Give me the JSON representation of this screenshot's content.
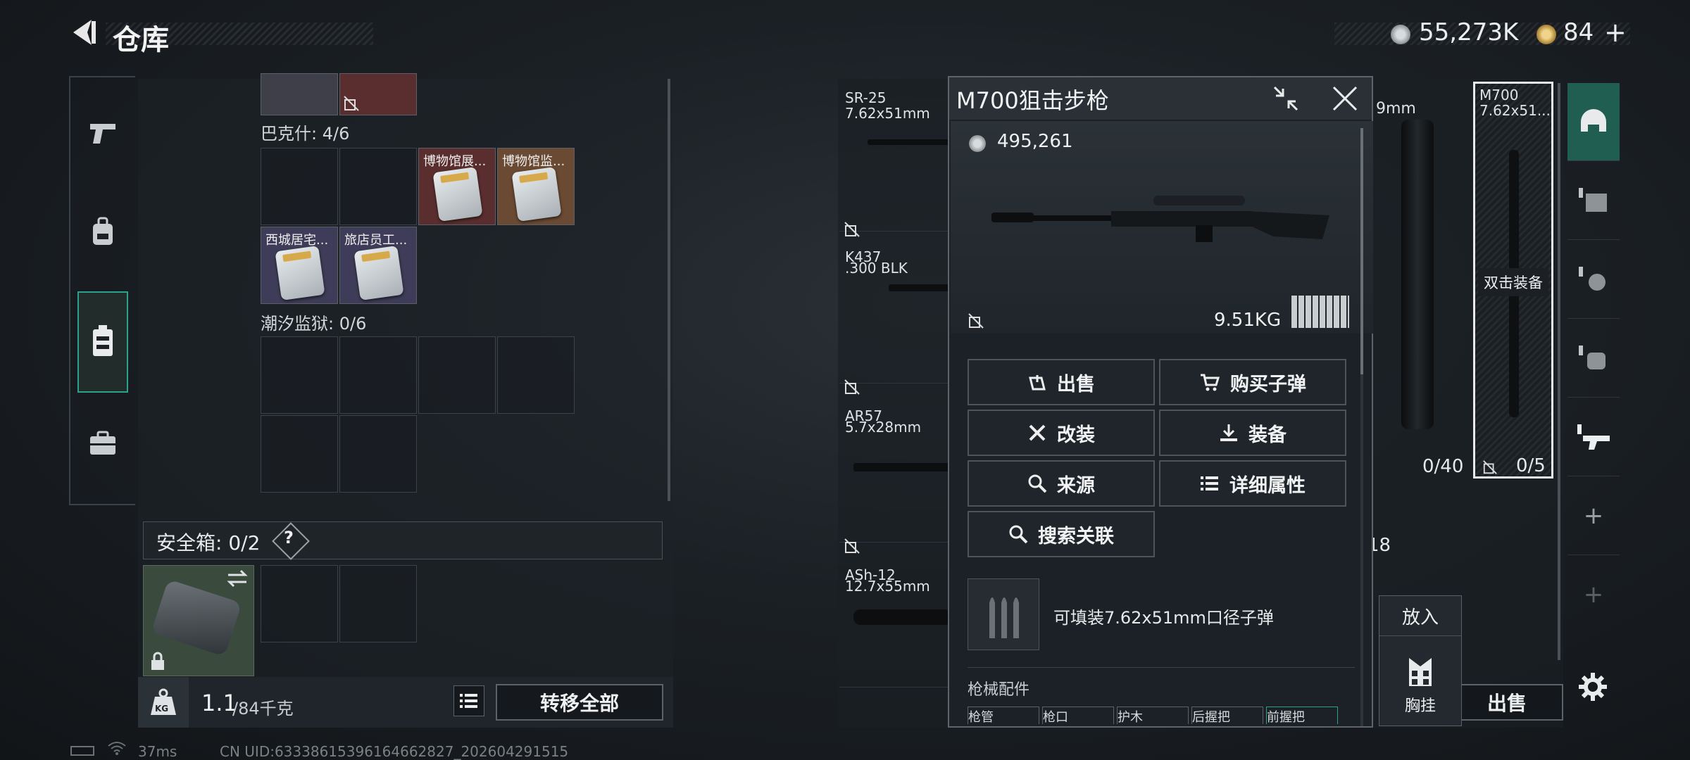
{
  "header": {
    "title": "仓库"
  },
  "currency": {
    "coins": "55,273K",
    "tickets": "84",
    "plus": "+"
  },
  "stash": {
    "top_items": [
      {
        "name": ""
      },
      {
        "name": ""
      }
    ],
    "sections": [
      {
        "label": "巴克什: 4/6",
        "items": [
          "博物馆展...",
          "博物馆监...",
          "西城居宅...",
          "旅店员工..."
        ]
      },
      {
        "label": "潮汐监狱: 0/6"
      }
    ],
    "safe_box_label": "安全箱: 0/2",
    "help": "?"
  },
  "bottom_left": {
    "weight": "1.1",
    "weight_cap": "/84千克",
    "transfer_all": "转移全部",
    "kg_badge": "KG"
  },
  "weapons_list": [
    {
      "name": "SR-25",
      "ammo": "7.62x51mm"
    },
    {
      "name": "K437",
      "ammo": ".300 BLK"
    },
    {
      "name": "AR57",
      "ammo": "5.7x28mm"
    },
    {
      "name": "ASh-12",
      "ammo": "12.7x55mm"
    }
  ],
  "popup": {
    "title": "M700狙击步枪",
    "price": "495,261",
    "weight": "9.51KG",
    "buttons": [
      "出售",
      "购买子弹",
      "改装",
      "装备",
      "来源",
      "详细属性",
      "搜索关联"
    ],
    "ammo_info": "可填装7.62x51mm口径子弹",
    "accessories_label": "枪械配件",
    "accessory_tabs": [
      "枪管",
      "枪口",
      "护木",
      "后握把",
      "前握把"
    ]
  },
  "right_slots": {
    "partial_ammo": "9mm",
    "count_a": "0/40",
    "count_b": "0/5",
    "m700_name": "M700",
    "m700_ammo": "7.62x51...",
    "equip_hint": "双击装备",
    "eighteen": "18",
    "sell": "出售",
    "put_in": "放入",
    "chest_rig": "胸挂"
  },
  "status": {
    "ping": "37ms",
    "uid": "CN UID:633386153961646628​27_202604291515"
  },
  "colors": {
    "accent": "#2ba38a",
    "item_red": "#5a2e2e",
    "item_orange": "#6a4a33",
    "item_purple": "#3e3c58"
  }
}
